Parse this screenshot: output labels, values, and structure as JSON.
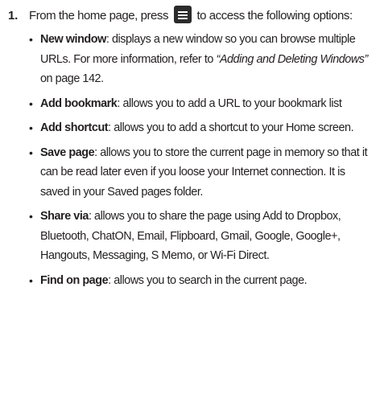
{
  "step": {
    "number": "1.",
    "intro_before_icon": "From the home page, press",
    "menu_icon": "menu-key-icon",
    "intro_after_icon": "to access the following options:"
  },
  "options": [
    {
      "name": "New window",
      "text": ": displays a new window so you can browse multiple URLs. For more information, refer to ",
      "reference": "“Adding and Deleting Windows”",
      "suffix": " on page 142."
    },
    {
      "name": "Add bookmark",
      "text": ": allows you to add a URL to your bookmark list"
    },
    {
      "name": "Add shortcut",
      "text": ": allows you to add a shortcut to your Home screen."
    },
    {
      "name": "Save page",
      "text": ": allows you to store the current page in memory so that it can be read later even if you loose your Internet connection. It is saved in your Saved pages folder."
    },
    {
      "name": "Share via",
      "text": ": allows you to share the page using Add to Dropbox, Bluetooth, ChatON, Email, Flipboard, Gmail, Google, Google+, Hangouts, Messaging, S Memo, or Wi-Fi Direct."
    },
    {
      "name": "Find on page",
      "text": ": allows you to search in the current page."
    }
  ]
}
